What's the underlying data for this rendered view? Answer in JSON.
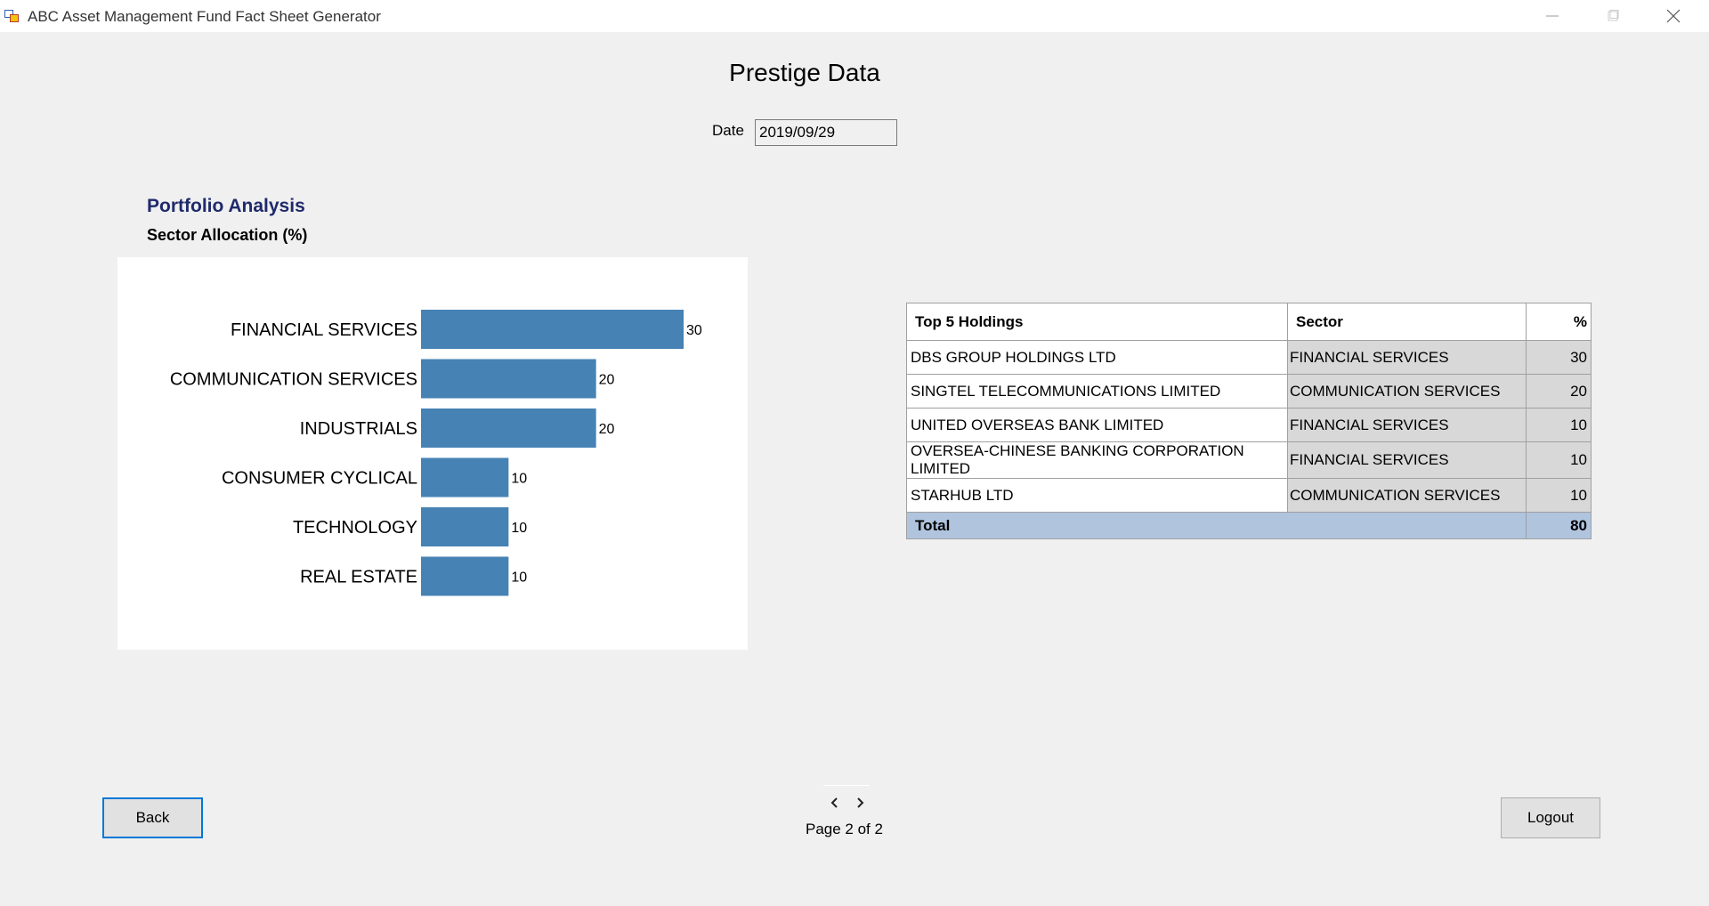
{
  "window": {
    "title": "ABC Asset Management Fund Fact Sheet Generator",
    "icons": [
      "app-icon",
      "minimize-icon",
      "maximize-icon",
      "close-icon"
    ]
  },
  "header": {
    "title": "Prestige Data",
    "date_label": "Date",
    "date_value": "2019/09/29"
  },
  "portfolio": {
    "title": "Portfolio Analysis",
    "subtitle": "Sector Allocation (%)"
  },
  "chart_data": {
    "type": "bar",
    "orientation": "horizontal",
    "categories": [
      "FINANCIAL SERVICES",
      "COMMUNICATION SERVICES",
      "INDUSTRIALS",
      "CONSUMER CYCLICAL",
      "TECHNOLOGY",
      "REAL ESTATE"
    ],
    "values": [
      30,
      20,
      20,
      10,
      10,
      10
    ],
    "data_labels": [
      "30",
      "20",
      "20",
      "10",
      "10",
      "10"
    ],
    "bar_color": "#4682b4",
    "grid": false,
    "legend": "none"
  },
  "holdings": {
    "headers": [
      "Top 5 Holdings",
      "Sector",
      "%"
    ],
    "rows": [
      {
        "name": "DBS GROUP HOLDINGS LTD",
        "sector": "FINANCIAL SERVICES",
        "pct": "30"
      },
      {
        "name": "SINGTEL TELECOMMUNICATIONS LIMITED",
        "sector": "COMMUNICATION SERVICES",
        "pct": "20"
      },
      {
        "name": "UNITED OVERSEAS BANK LIMITED",
        "sector": "FINANCIAL SERVICES",
        "pct": "10"
      },
      {
        "name": "OVERSEA-CHINESE BANKING CORPORATION LIMITED",
        "sector": "FINANCIAL SERVICES",
        "pct": "10"
      },
      {
        "name": "STARHUB LTD",
        "sector": "COMMUNICATION SERVICES",
        "pct": "10"
      }
    ],
    "total_label": "Total",
    "total_value": "80",
    "total_color": "#b0c4de"
  },
  "footer": {
    "back_label": "Back",
    "logout_label": "Logout",
    "page_text": "Page 2 of 2",
    "prev_icon": "chevron-left-icon",
    "next_icon": "chevron-right-icon"
  }
}
